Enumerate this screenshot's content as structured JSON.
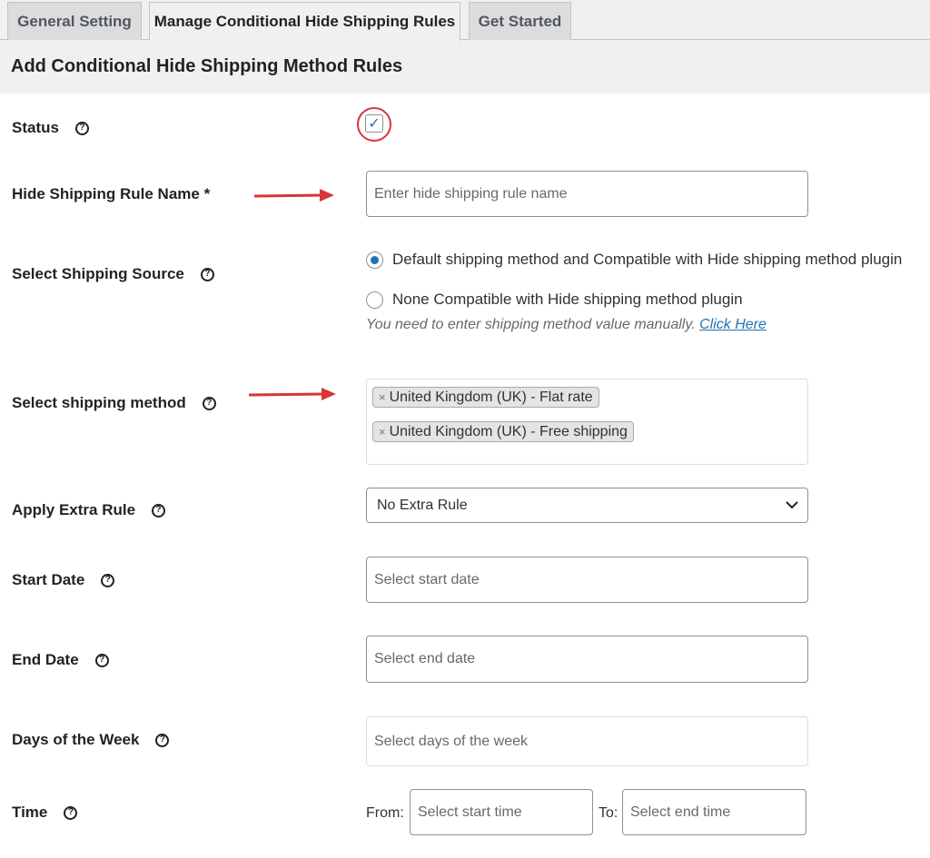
{
  "tabs": [
    {
      "label": "General Setting",
      "active": false
    },
    {
      "label": "Manage Conditional Hide Shipping Rules",
      "active": true
    },
    {
      "label": "Get Started",
      "active": false
    }
  ],
  "page_title": "Add Conditional Hide Shipping Method Rules",
  "form": {
    "status": {
      "label": "Status",
      "checked": true
    },
    "rule_name": {
      "label": "Hide Shipping Rule Name *",
      "placeholder": "Enter hide shipping rule name"
    },
    "shipping_source": {
      "label": "Select Shipping Source",
      "options": [
        {
          "label": "Default shipping method and Compatible with Hide shipping method plugin",
          "selected": true
        },
        {
          "label": "None Compatible with Hide shipping method plugin",
          "selected": false
        }
      ],
      "hint": "You need to enter shipping method value manually.",
      "hint_link": "Click Here"
    },
    "shipping_method": {
      "label": "Select shipping method",
      "tags": [
        "United Kingdom (UK) - Flat rate",
        "United Kingdom (UK) - Free shipping"
      ],
      "remove_symbol": "×"
    },
    "extra_rule": {
      "label": "Apply Extra Rule",
      "value": "No Extra Rule"
    },
    "start_date": {
      "label": "Start Date",
      "placeholder": "Select start date"
    },
    "end_date": {
      "label": "End Date",
      "placeholder": "Select end date"
    },
    "days_of_week": {
      "label": "Days of the Week",
      "placeholder": "Select days of the week"
    },
    "time": {
      "label": "Time",
      "from_label": "From:",
      "from_placeholder": "Select start time",
      "to_label": "To:",
      "to_placeholder": "Select end time"
    }
  },
  "icons": {
    "help": "question-circle-icon",
    "check": "checkmark-icon",
    "arrow": "red-arrow-icon",
    "chevron": "chevron-down-icon"
  },
  "colors": {
    "accent": "#2271b1",
    "annotation": "#d63638",
    "panel_bg": "#f0f0f1"
  }
}
